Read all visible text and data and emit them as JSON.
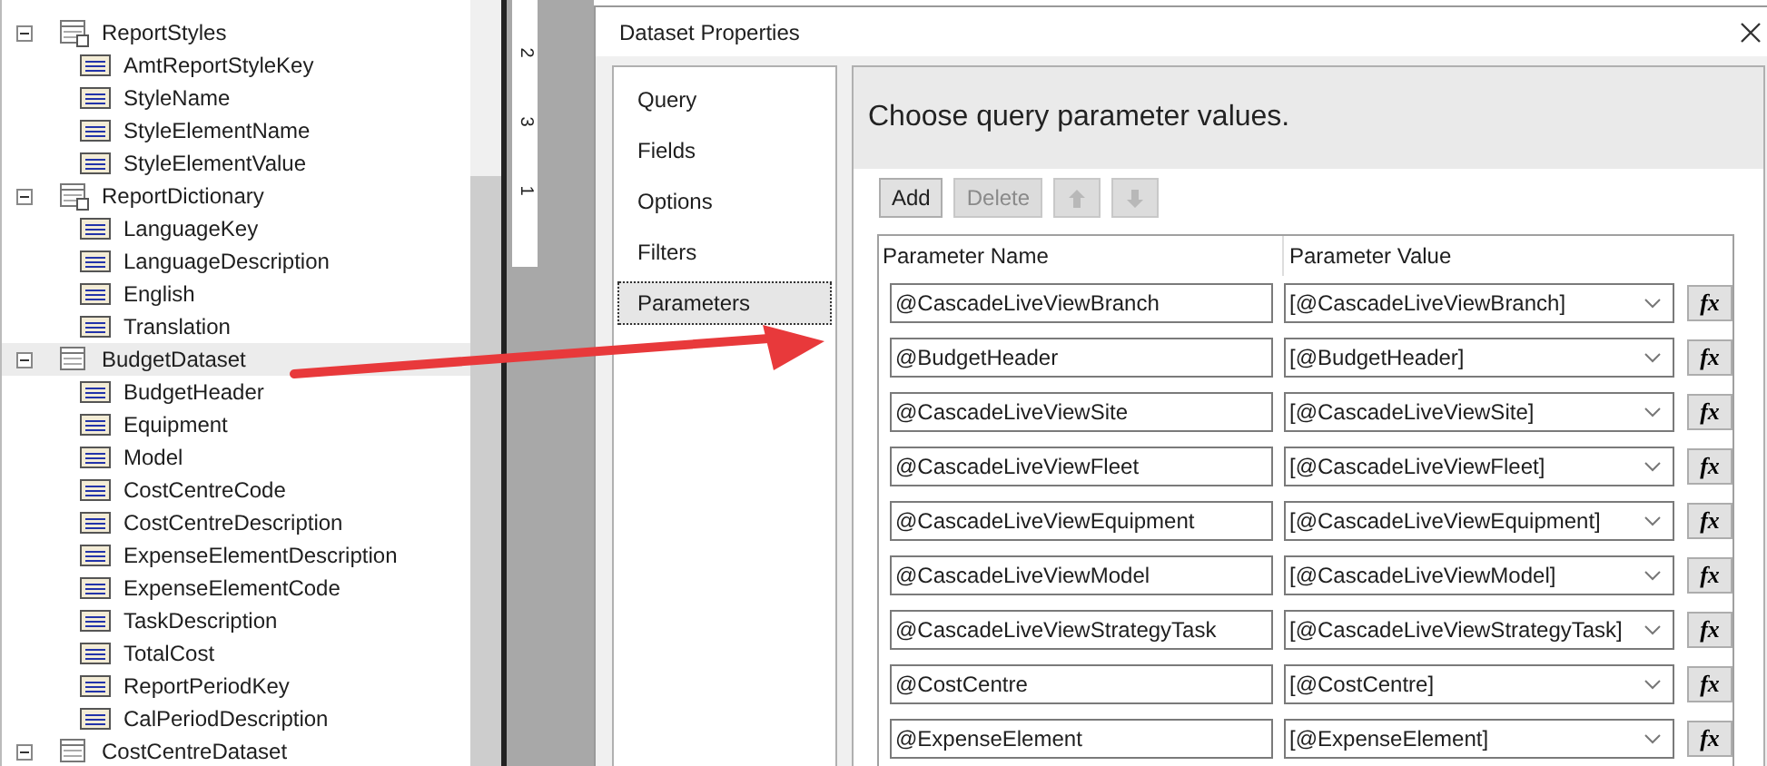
{
  "tree": [
    {
      "label": "ReportStyles",
      "kind": "dataset",
      "expanded": true,
      "selected": false,
      "children": [
        {
          "label": "AmtReportStyleKey",
          "kind": "field",
          "selected": false
        },
        {
          "label": "StyleName",
          "kind": "field",
          "selected": false
        },
        {
          "label": "StyleElementName",
          "kind": "field",
          "selected": false
        },
        {
          "label": "StyleElementValue",
          "kind": "field",
          "selected": false
        }
      ]
    },
    {
      "label": "ReportDictionary",
      "kind": "dataset",
      "expanded": true,
      "selected": false,
      "children": [
        {
          "label": "LanguageKey",
          "kind": "field",
          "selected": false
        },
        {
          "label": "LanguageDescription",
          "kind": "field",
          "selected": false
        },
        {
          "label": "English",
          "kind": "field",
          "selected": false
        },
        {
          "label": "Translation",
          "kind": "field",
          "selected": false
        }
      ]
    },
    {
      "label": "BudgetDataset",
      "kind": "table",
      "expanded": true,
      "selected": true,
      "children": [
        {
          "label": "BudgetHeader",
          "kind": "field",
          "selected": false
        },
        {
          "label": "Equipment",
          "kind": "field",
          "selected": false
        },
        {
          "label": "Model",
          "kind": "field",
          "selected": false
        },
        {
          "label": "CostCentreCode",
          "kind": "field",
          "selected": false
        },
        {
          "label": "CostCentreDescription",
          "kind": "field",
          "selected": false
        },
        {
          "label": "ExpenseElementDescription",
          "kind": "field",
          "selected": false
        },
        {
          "label": "ExpenseElementCode",
          "kind": "field",
          "selected": false
        },
        {
          "label": "TaskDescription",
          "kind": "field",
          "selected": false
        },
        {
          "label": "TotalCost",
          "kind": "field",
          "selected": false
        },
        {
          "label": "ReportPeriodKey",
          "kind": "field",
          "selected": false
        },
        {
          "label": "CalPeriodDescription",
          "kind": "field",
          "selected": false
        }
      ]
    },
    {
      "label": "CostCentreDataset",
      "kind": "table",
      "expanded": true,
      "selected": false
    }
  ],
  "ruler_marks": [
    "2",
    "3",
    "1"
  ],
  "dialog": {
    "title": "Dataset Properties",
    "nav": [
      {
        "label": "Query",
        "selected": false
      },
      {
        "label": "Fields",
        "selected": false
      },
      {
        "label": "Options",
        "selected": false
      },
      {
        "label": "Filters",
        "selected": false
      },
      {
        "label": "Parameters",
        "selected": true
      }
    ],
    "heading": "Choose query parameter values.",
    "toolbar": [
      {
        "kind": "text",
        "label": "Add",
        "disabled": false
      },
      {
        "kind": "text",
        "label": "Delete",
        "disabled": true
      },
      {
        "kind": "up",
        "disabled": true
      },
      {
        "kind": "down",
        "disabled": true
      }
    ],
    "columns": [
      "Parameter Name",
      "Parameter Value"
    ],
    "rows": [
      {
        "name": "@CascadeLiveViewBranch",
        "value": "[@CascadeLiveViewBranch]",
        "function_label": "fx"
      },
      {
        "name": "@BudgetHeader",
        "value": "[@BudgetHeader]",
        "function_label": "fx"
      },
      {
        "name": "@CascadeLiveViewSite",
        "value": "[@CascadeLiveViewSite]",
        "function_label": "fx"
      },
      {
        "name": "@CascadeLiveViewFleet",
        "value": "[@CascadeLiveViewFleet]",
        "function_label": "fx"
      },
      {
        "name": "@CascadeLiveViewEquipment",
        "value": "[@CascadeLiveViewEquipment]",
        "function_label": "fx"
      },
      {
        "name": "@CascadeLiveViewModel",
        "value": "[@CascadeLiveViewModel]",
        "function_label": "fx"
      },
      {
        "name": "@CascadeLiveViewStrategyTask",
        "value": "[@CascadeLiveViewStrategyTask]",
        "function_label": "fx"
      },
      {
        "name": "@CostCentre",
        "value": "[@CostCentre]",
        "function_label": "fx"
      },
      {
        "name": "@ExpenseElement",
        "value": "[@ExpenseElement]",
        "function_label": "fx"
      }
    ]
  }
}
